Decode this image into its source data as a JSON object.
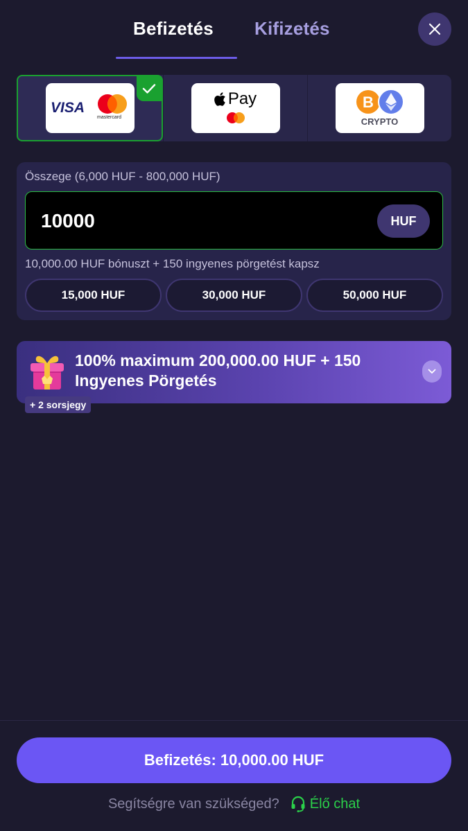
{
  "tabs": {
    "deposit": "Befizetés",
    "withdraw": "Kifizetés"
  },
  "payment_methods": [
    {
      "id": "card",
      "visa": "VISA",
      "mastercard": "mastercard",
      "selected": true
    },
    {
      "id": "applepay",
      "label": "Pay",
      "selected": false
    },
    {
      "id": "crypto",
      "label": "CRYPTO",
      "selected": false
    }
  ],
  "amount": {
    "label": "Összege (6,000 HUF - 800,000 HUF)",
    "value": "10000",
    "currency": "HUF",
    "bonus_info": "10,000.00 HUF bónuszt + 150 ingyenes pörgetést kapsz",
    "quick_amounts": [
      "15,000 HUF",
      "30,000 HUF",
      "50,000 HUF"
    ]
  },
  "promo": {
    "text": "100% maximum 200,000.00 HUF + 150 Ingyenes Pörgetés",
    "ticket_badge": "+ 2 sorsjegy"
  },
  "footer": {
    "submit_label": "Befizetés: 10,000.00 HUF",
    "help_text": "Segítségre van szükséged?",
    "chat_label": "Élő chat"
  },
  "colors": {
    "background": "#1c1a2e",
    "accent": "#6b56f4",
    "success": "#1aa130",
    "chat": "#2bd14a"
  },
  "icons": [
    "close-icon",
    "check-icon",
    "apple-icon",
    "bitcoin-icon",
    "ethereum-icon",
    "gift-icon",
    "chevron-down-icon",
    "headset-icon"
  ]
}
